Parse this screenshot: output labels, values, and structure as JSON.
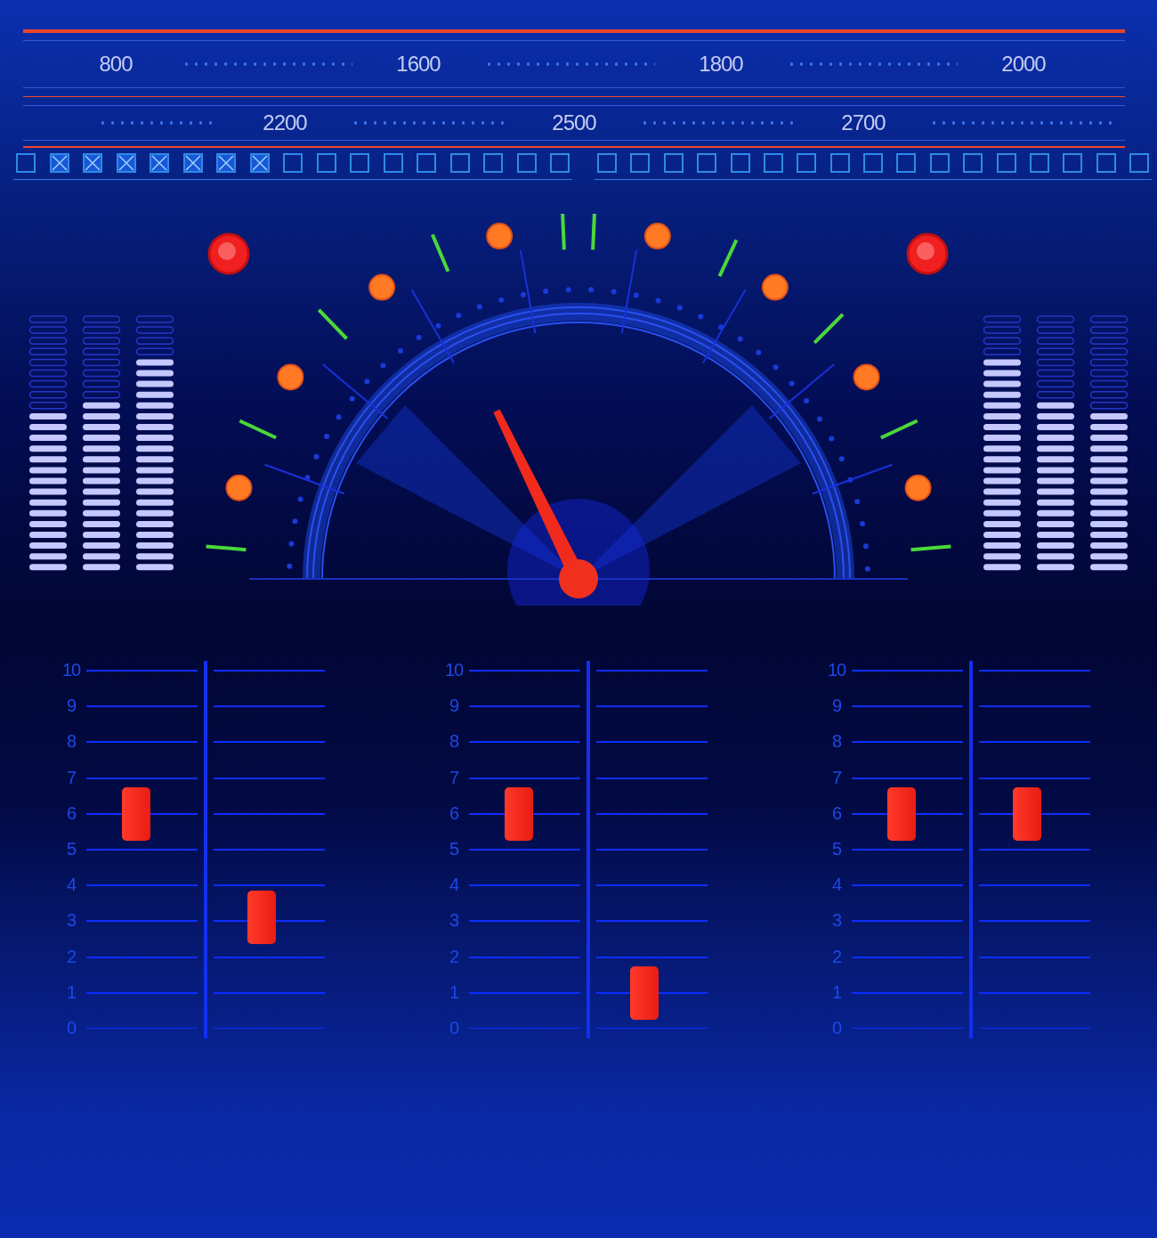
{
  "frequency_scale": {
    "rows": [
      {
        "labels": [
          "800",
          "1600",
          "1800",
          "2000"
        ]
      },
      {
        "labels": [
          "2200",
          "2500",
          "2700"
        ]
      }
    ]
  },
  "indicators": [
    {
      "checked": false
    },
    {
      "checked": true
    },
    {
      "checked": true
    },
    {
      "checked": true
    },
    {
      "checked": true
    },
    {
      "checked": true
    },
    {
      "checked": true
    },
    {
      "checked": true
    },
    {
      "checked": false
    },
    {
      "checked": false
    },
    {
      "checked": false
    },
    {
      "checked": false
    },
    {
      "checked": false
    },
    {
      "checked": false
    },
    {
      "checked": false
    },
    {
      "checked": false
    },
    {
      "checked": false
    },
    {
      "checked": false
    },
    {
      "checked": false
    },
    {
      "checked": false
    },
    {
      "checked": false
    },
    {
      "checked": false
    },
    {
      "checked": false
    },
    {
      "checked": false
    },
    {
      "checked": false
    },
    {
      "checked": false
    },
    {
      "checked": false
    },
    {
      "checked": false
    },
    {
      "checked": false
    },
    {
      "checked": false
    },
    {
      "checked": false
    },
    {
      "checked": false
    },
    {
      "checked": false
    },
    {
      "checked": false
    }
  ],
  "left_meters": [
    {
      "level": 0.62
    },
    {
      "level": 0.66
    },
    {
      "level": 0.85
    }
  ],
  "right_meters": [
    {
      "level": 0.85
    },
    {
      "level": 0.66
    },
    {
      "level": 0.62
    }
  ],
  "slider_groups": [
    {
      "scale_labels": [
        "10",
        "9",
        "8",
        "7",
        "6",
        "5",
        "4",
        "3",
        "2",
        "1",
        "0"
      ],
      "sliders": [
        {
          "level": 0.6
        },
        {
          "level": 0.31
        }
      ]
    },
    {
      "scale_labels": [
        "10",
        "9",
        "8",
        "7",
        "6",
        "5",
        "4",
        "3",
        "2",
        "1",
        "0"
      ],
      "sliders": [
        {
          "level": 0.6
        },
        {
          "level": 0.1
        }
      ]
    },
    {
      "scale_labels": [
        "10",
        "9",
        "8",
        "7",
        "6",
        "5",
        "4",
        "3",
        "2",
        "1",
        "0"
      ],
      "sliders": [
        {
          "level": 0.6
        },
        {
          "level": 0.6
        }
      ]
    }
  ]
}
